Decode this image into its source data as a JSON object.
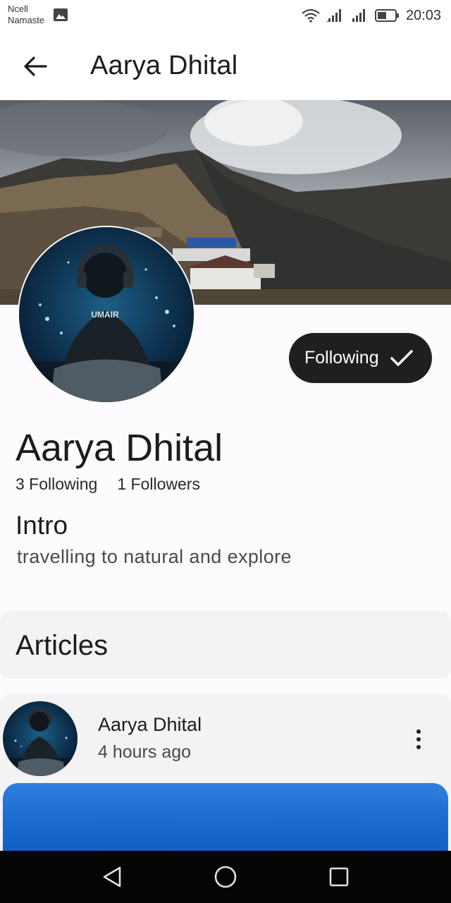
{
  "status_bar": {
    "carrier_line1": "Ncell",
    "carrier_line2": "Namaste",
    "time": "20:03",
    "icons": [
      "gallery-icon",
      "wifi-icon",
      "signal-icon",
      "signal-icon",
      "battery-icon"
    ]
  },
  "app_bar": {
    "title": "Aarya Dhital",
    "back_icon": "arrow-left-icon"
  },
  "profile": {
    "name": "Aarya Dhital",
    "following_count": "3 Following",
    "followers_count": "1 Followers",
    "follow_button_label": "Following",
    "follow_button_icon": "check-icon",
    "intro_title": "Intro",
    "intro_text": "travelling to natural and explore",
    "avatar_shirt_text": "UMAIR"
  },
  "articles": {
    "title": "Articles",
    "items": [
      {
        "author": "Aarya Dhital",
        "time": "4 hours ago",
        "menu_icon": "more-vertical-icon"
      }
    ]
  },
  "nav_bar": {
    "buttons": [
      "back-triangle-icon",
      "home-circle-icon",
      "recents-square-icon"
    ]
  },
  "colors": {
    "follow_button_bg": "#1f1f1f",
    "page_bg": "#fdfbfd",
    "card_bg": "#f2f3f2",
    "article_image_blue": "#1665c8"
  }
}
